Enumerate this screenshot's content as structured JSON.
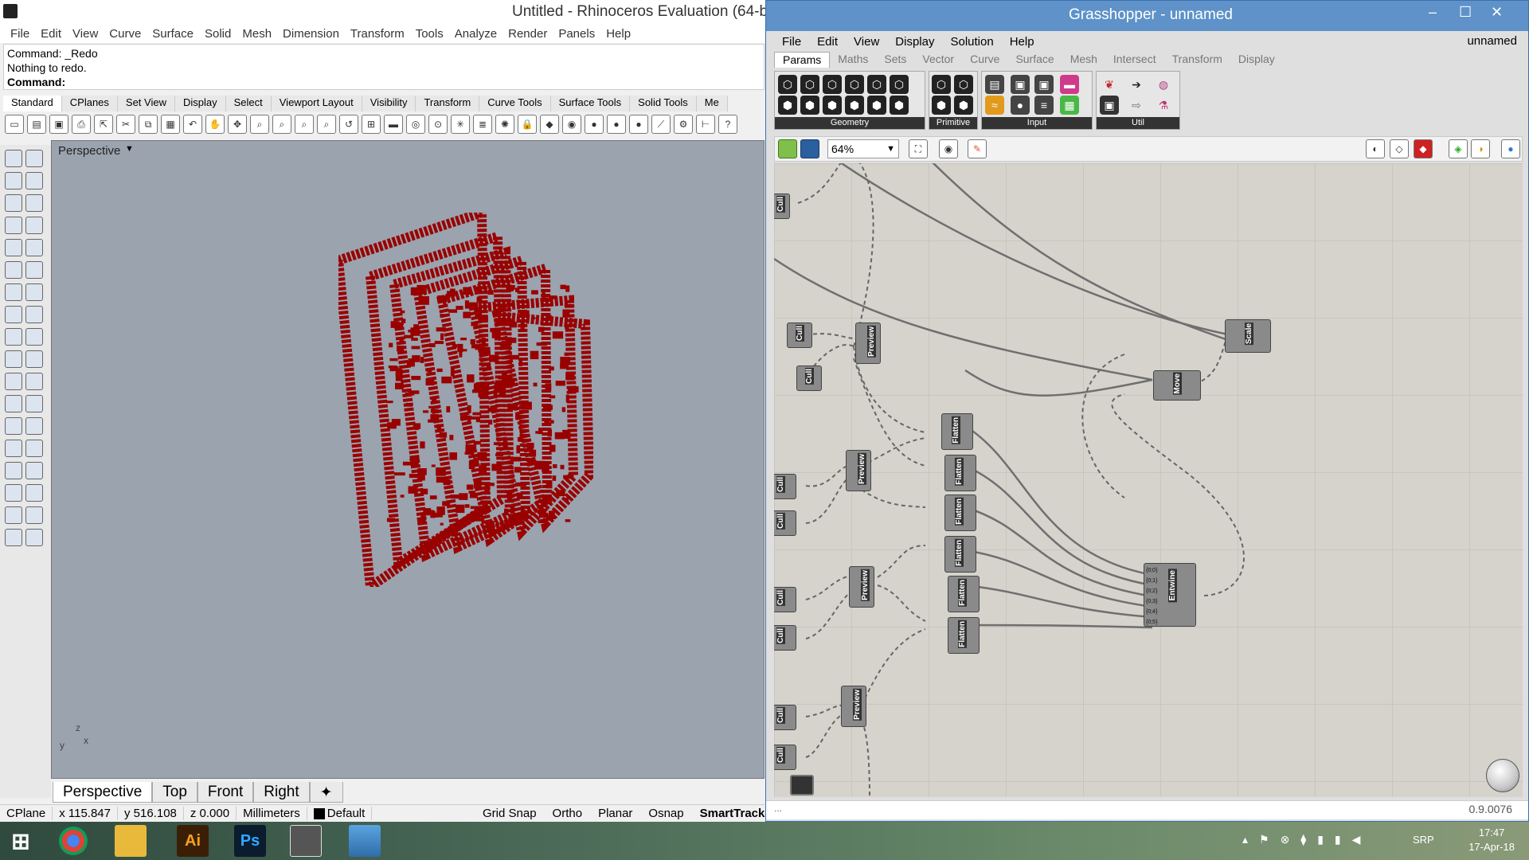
{
  "rhino": {
    "title": "Untitled - Rhinoceros Evaluation (64-b",
    "menu": [
      "File",
      "Edit",
      "View",
      "Curve",
      "Surface",
      "Solid",
      "Mesh",
      "Dimension",
      "Transform",
      "Tools",
      "Analyze",
      "Render",
      "Panels",
      "Help"
    ],
    "command": {
      "line1": "Command: _Redo",
      "line2": "Nothing to redo.",
      "prompt": "Command:"
    },
    "toolbar_tabs": [
      "Standard",
      "CPlanes",
      "Set View",
      "Display",
      "Select",
      "Viewport Layout",
      "Visibility",
      "Transform",
      "Curve Tools",
      "Surface Tools",
      "Solid Tools",
      "Me"
    ],
    "viewport_label": "Perspective",
    "axes_labels": {
      "z": "z",
      "y": "y",
      "x": "x"
    },
    "viewport_tabs": [
      "Perspective",
      "Top",
      "Front",
      "Right"
    ],
    "viewport_tab_add": "✦",
    "status": {
      "cplane": "CPlane",
      "x": "x 115.847",
      "y": "y 516.108",
      "z": "z 0.000",
      "units": "Millimeters",
      "layer": "Default"
    },
    "status_toggles": [
      "Grid Snap",
      "Ortho",
      "Planar",
      "Osnap",
      "SmartTrack"
    ],
    "model_color": "#990000",
    "viewport_bg": "#9ba3ae"
  },
  "gh": {
    "title": "Grasshopper - unnamed",
    "window_buttons": [
      "–",
      "☐",
      "✕"
    ],
    "menu": [
      "File",
      "Edit",
      "View",
      "Display",
      "Solution",
      "Help"
    ],
    "doc_name": "unnamed",
    "component_tabs": [
      "Params",
      "Maths",
      "Sets",
      "Vector",
      "Curve",
      "Surface",
      "Mesh",
      "Intersect",
      "Transform",
      "Display"
    ],
    "ribbon_groups": [
      "Geometry",
      "Primitive",
      "Input",
      "Util"
    ],
    "zoom": "64%",
    "version": "0.9.0076",
    "status_dots": "...",
    "nodes": {
      "cull": "Cull",
      "preview": "Preview",
      "flatten": "Flatten",
      "entwine": "Entwine",
      "move": "Move",
      "scale": "Scale"
    },
    "entwine_inputs": [
      "{0;0}",
      "{0;1}",
      "{0;2}",
      "{0;3}",
      "{0;4}",
      "{0;5}"
    ]
  },
  "taskbar": {
    "apps": [
      "chrome",
      "explorer",
      "Ai",
      "Ps",
      "rhino",
      "photos"
    ],
    "lang": "SRP",
    "time": "17:47",
    "date": "17-Apr-18"
  }
}
